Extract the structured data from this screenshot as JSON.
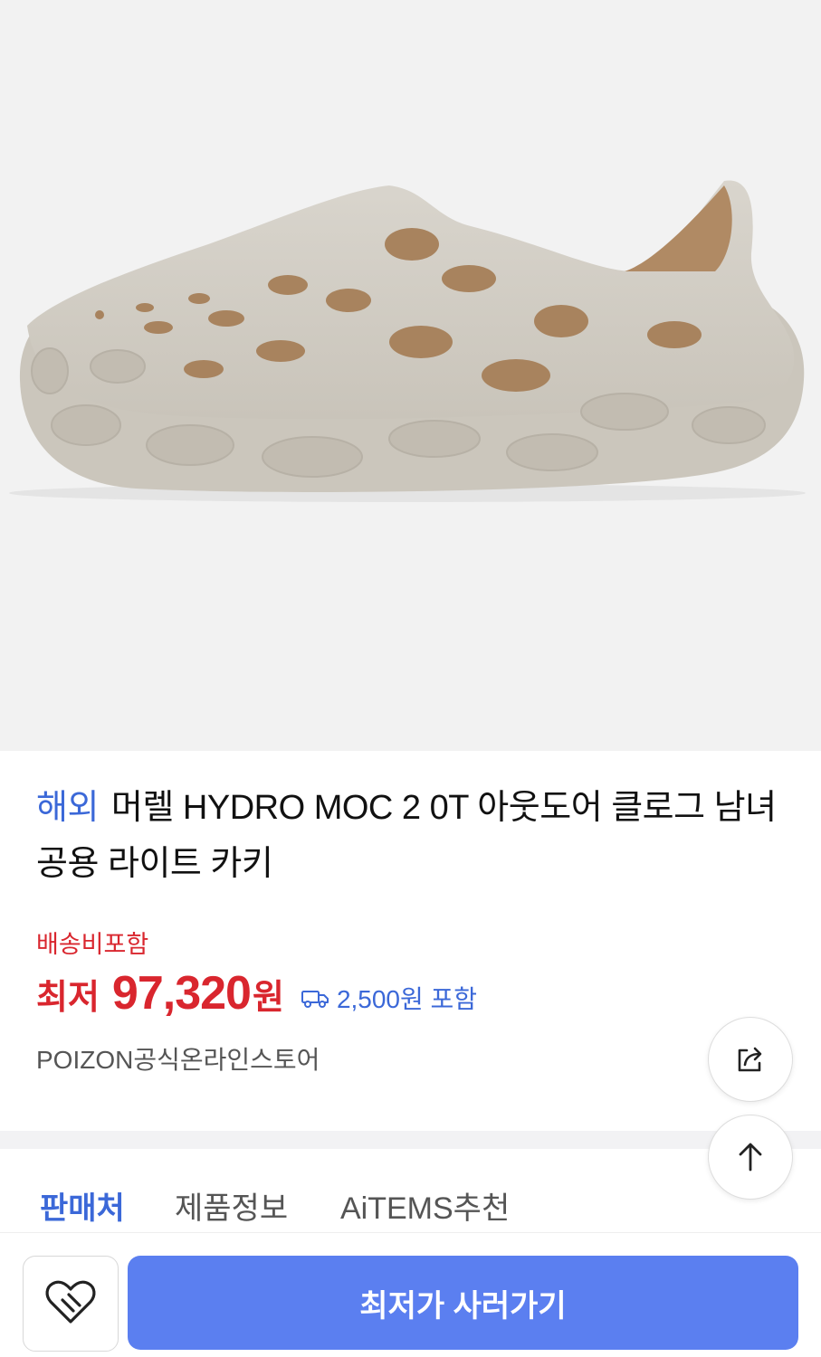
{
  "product": {
    "image_icon": "shoe-product-image",
    "tag": "해외",
    "name": "머렐 HYDRO MOC 2 0T 아웃도어 클로그 남녀 공용 라이트 카키",
    "shipping_note": "배송비포함",
    "price_label": "최저",
    "price": "97,320",
    "price_unit": "원",
    "delivery_fee": "2,500원 포함",
    "seller": "POIZON공식온라인스토어"
  },
  "tabs": [
    {
      "label": "판매처",
      "active": true
    },
    {
      "label": "제품정보",
      "active": false
    },
    {
      "label": "AiTEMS추천",
      "active": false
    }
  ],
  "floating": {
    "share_icon": "share-icon",
    "top_icon": "arrow-up-icon"
  },
  "bottom": {
    "wish_icon": "heart-icon",
    "buy_label": "최저가 사러가기"
  },
  "colors": {
    "accent_blue": "#3b68d8",
    "price_red": "#d9262e",
    "button_blue": "#5b7ff0"
  }
}
